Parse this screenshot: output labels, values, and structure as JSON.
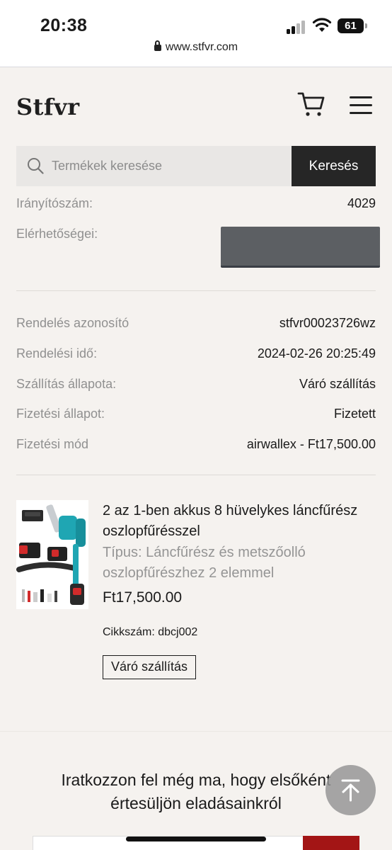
{
  "status_bar": {
    "time": "20:38",
    "battery": "61"
  },
  "browser": {
    "url": "www.stfvr.com"
  },
  "header": {
    "logo": "Stfvr",
    "search_placeholder": "Termékek keresése",
    "search_button": "Keresés"
  },
  "address": {
    "postcode_label": "Irányítószám:",
    "postcode_value": "4029",
    "contact_label": "Elérhetőségei:"
  },
  "order": {
    "rows": [
      {
        "label": "Rendelés azonosító",
        "value": "stfvr00023726wz"
      },
      {
        "label": "Rendelési idő:",
        "value": "2024-02-26 20:25:49"
      },
      {
        "label": "Szállítás állapota:",
        "value": "Váró szállítás"
      },
      {
        "label": "Fizetési állapot:",
        "value": "Fizetett"
      },
      {
        "label": "Fizetési mód",
        "value": "airwallex -  Ft17,500.00"
      }
    ]
  },
  "product": {
    "title": "2 az 1-ben akkus 8 hüvelykes láncfűrész oszlopfűrésszel",
    "variant": "Típus: Láncfűrész és metszőolló oszlopfűrészhez 2 elemmel",
    "price": "Ft17,500.00",
    "sku": "Cikkszám: dbcj002",
    "status": "Váró szállítás"
  },
  "newsletter": {
    "heading": "Iratkozzon fel még ma, hogy elsőként értesüljön eladásainkról"
  },
  "colors": {
    "accent": "#262626",
    "background": "#f5f2ef",
    "newsletter_button": "#a31515"
  },
  "icons": [
    "lock-icon",
    "cart-icon",
    "menu-icon",
    "search-icon",
    "arrow-up-icon"
  ]
}
